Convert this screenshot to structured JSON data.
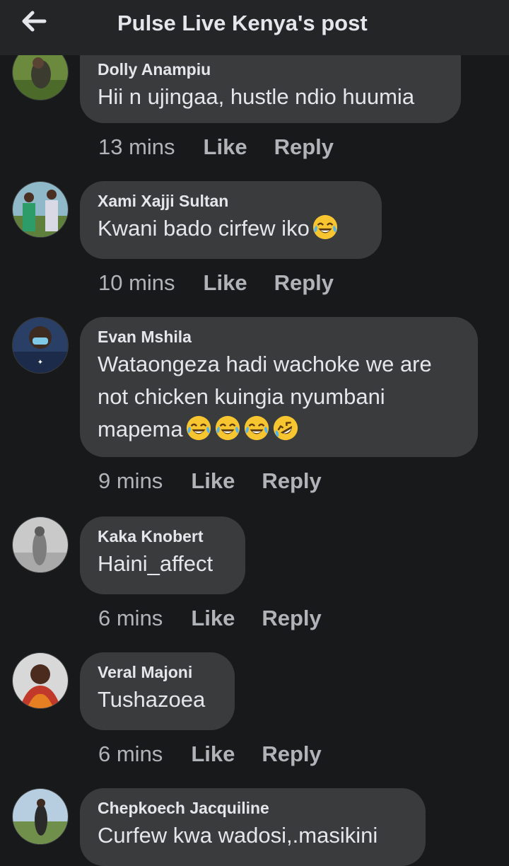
{
  "header": {
    "title": "Pulse Live Kenya's post",
    "back_icon": "back-arrow-icon"
  },
  "actions": {
    "like": "Like",
    "reply": "Reply"
  },
  "colors": {
    "background": "#18191a",
    "bubble": "#3a3b3c",
    "meta": "#b0b3b8",
    "text": "#e4e6eb"
  },
  "comments": [
    {
      "name": "Dolly Anampiu",
      "text": "Hii n ujingaa, hustle ndio huumia",
      "time": "13 mins"
    },
    {
      "name": "Xami Xajji Sultan",
      "text": "Kwani bado cirfew iko",
      "emoji": [
        "face-with-tears-of-joy"
      ],
      "time": "10 mins"
    },
    {
      "name": "Evan Mshila",
      "text": "Wataongeza hadi wachoke we are not chicken kuingia nyumbani mapema",
      "emoji": [
        "face-with-tears-of-joy",
        "face-with-tears-of-joy",
        "face-with-tears-of-joy",
        "rolling-on-floor-laughing"
      ],
      "time": "9 mins"
    },
    {
      "name": "Kaka Knobert",
      "text": "Haini_affect",
      "time": "6 mins"
    },
    {
      "name": "Veral Majoni",
      "text": "Tushazoea",
      "time": "6 mins"
    },
    {
      "name": "Chepkoech Jacquiline",
      "text": "Curfew kwa wadosi,.masikini",
      "time": ""
    }
  ]
}
